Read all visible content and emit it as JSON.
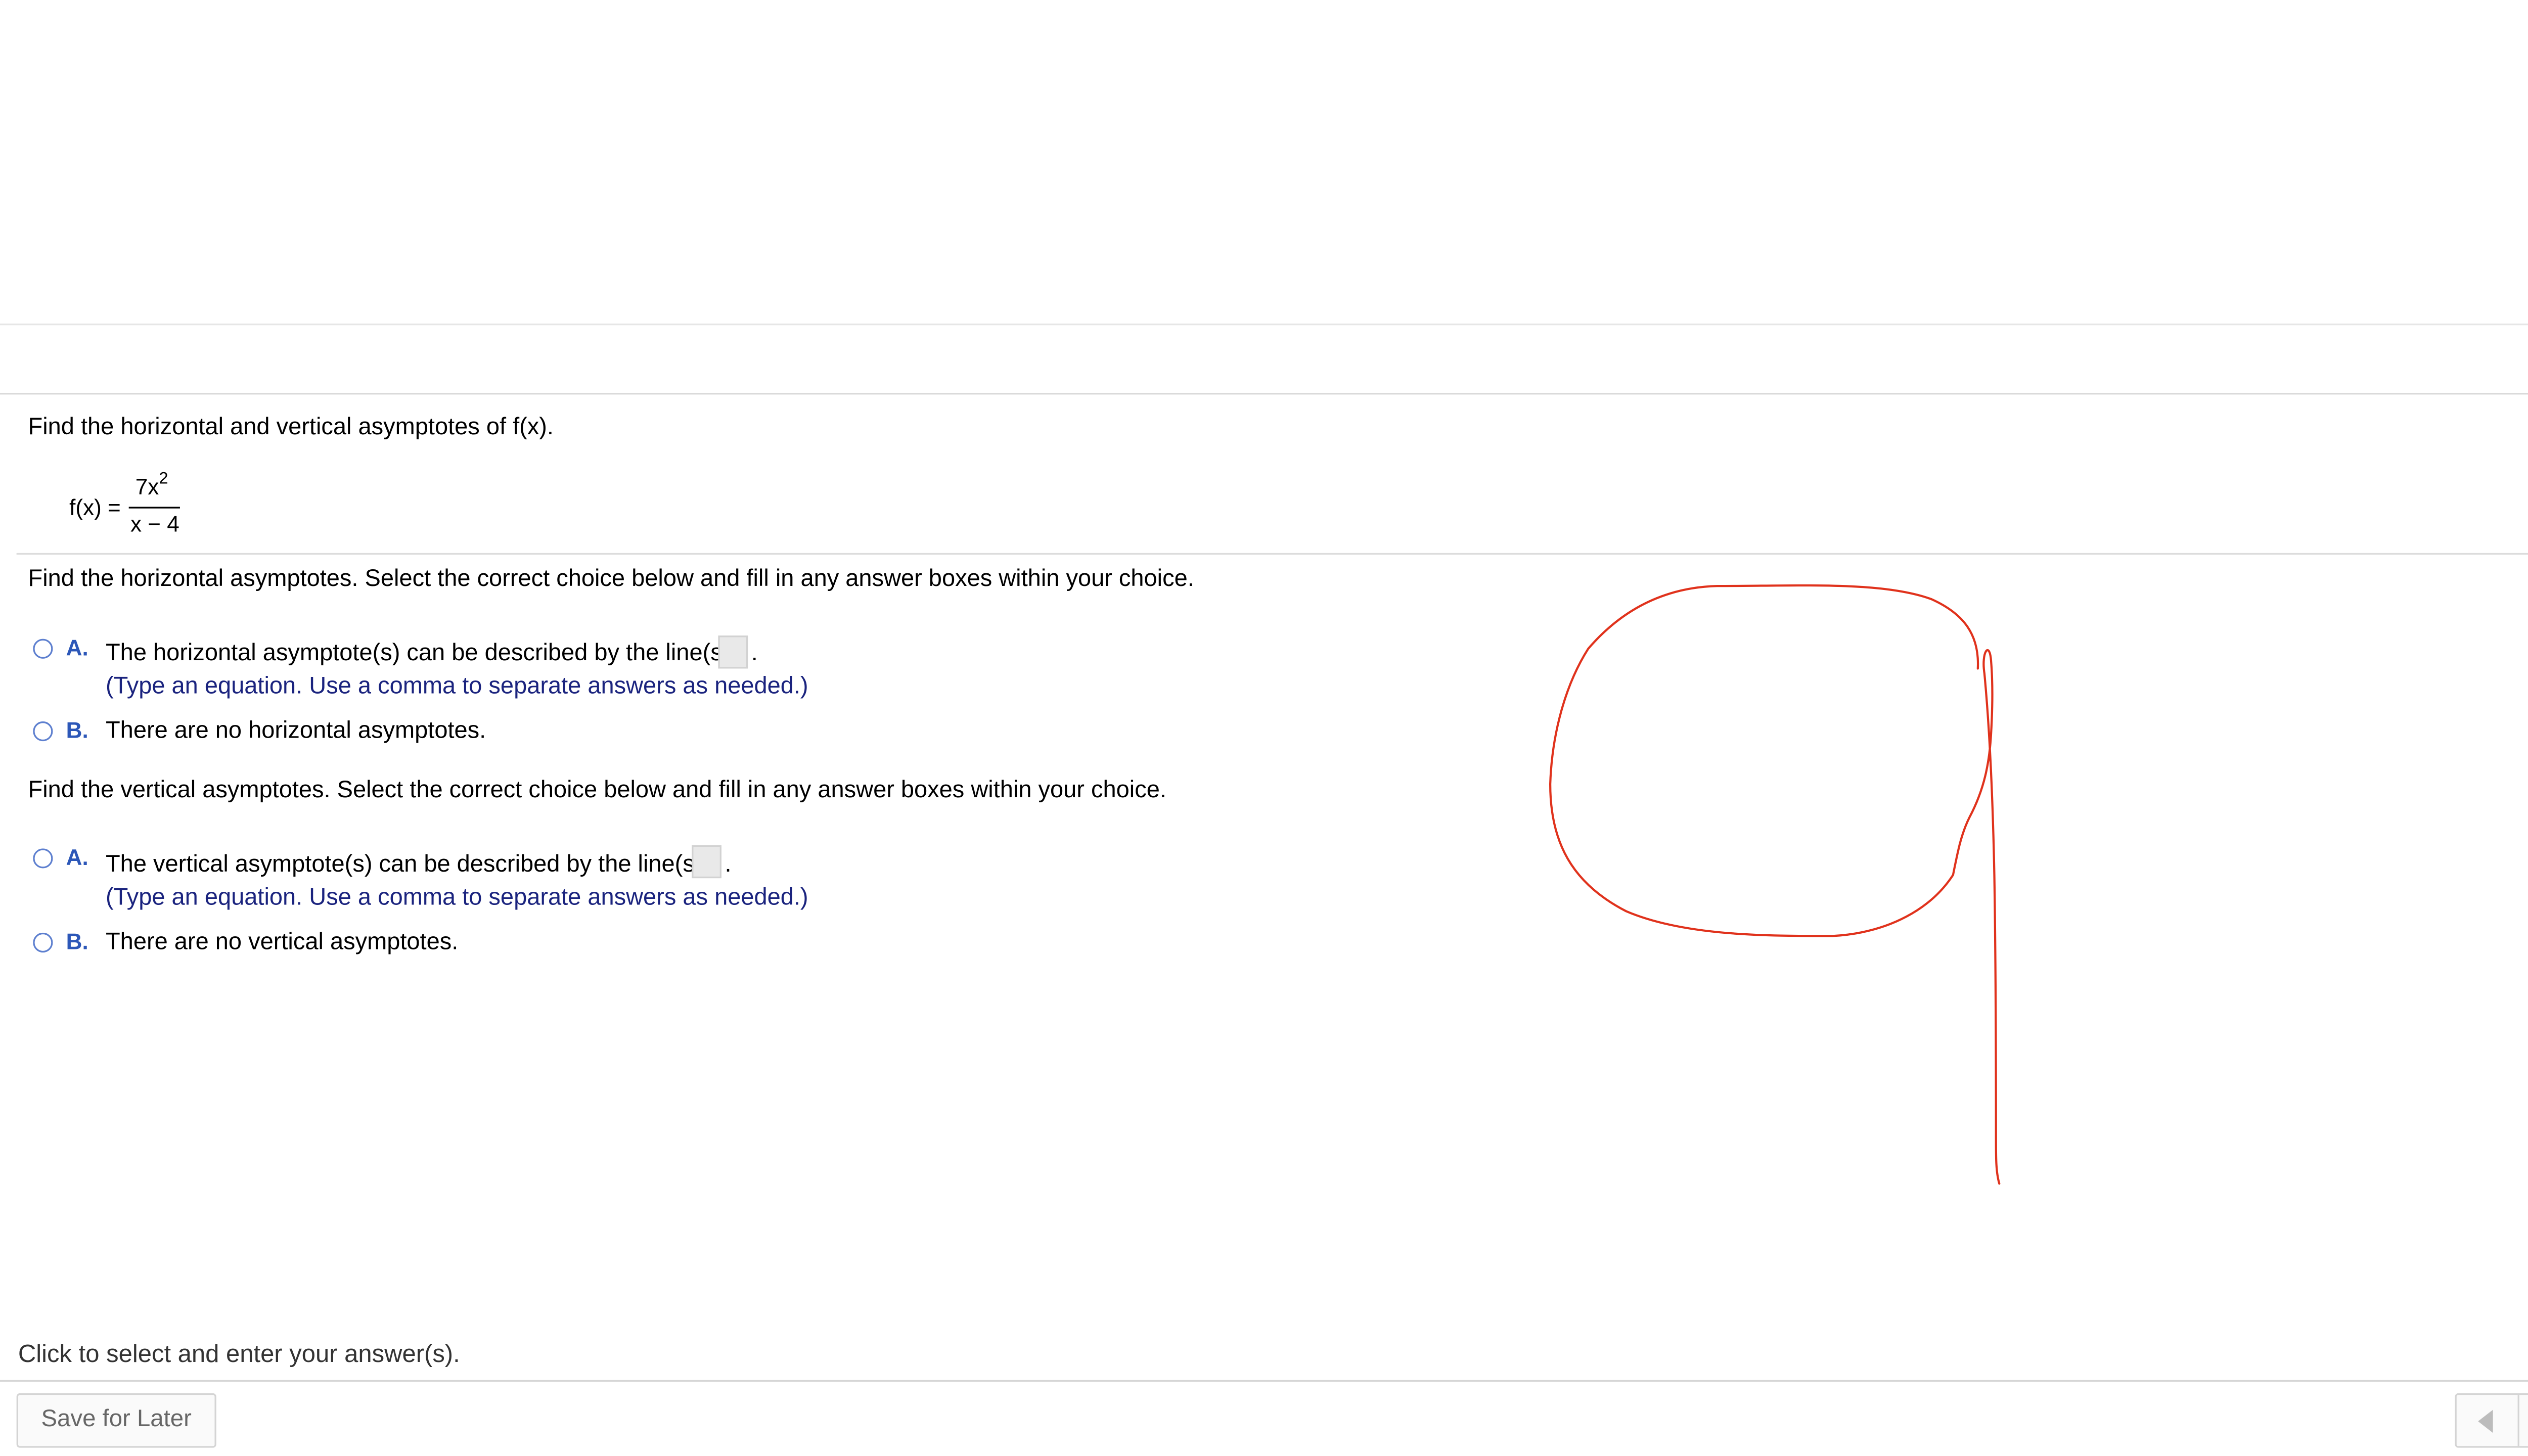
{
  "toolbar": {
    "settings_icon": "gear-icon"
  },
  "question": {
    "prompt": "Find the horizontal and vertical asymptotes of f(x).",
    "function": {
      "label": "f(x) =",
      "numerator_base": "7x",
      "numerator_exponent": "2",
      "denominator": "x − 4"
    }
  },
  "horizontal": {
    "instruction": "Find the horizontal asymptotes. Select the correct choice below and fill in any answer boxes within your choice.",
    "choice_a": {
      "letter": "A.",
      "text": "The horizontal asymptote(s) can be described by the line(s)",
      "answer_value": "",
      "period": ".",
      "hint": "(Type an equation. Use a comma to separate answers as needed.)",
      "selected": false
    },
    "choice_b": {
      "letter": "B.",
      "text": "There are no horizontal asymptotes.",
      "selected": false
    }
  },
  "vertical": {
    "instruction": "Find the vertical asymptotes. Select the correct choice below and fill in any answer boxes within your choice.",
    "choice_a": {
      "letter": "A.",
      "text": "The vertical asymptote(s) can be described by the line(s)",
      "answer_value": "",
      "period": ".",
      "hint": "(Type an equation. Use a comma to separate answers as needed.)",
      "selected": false
    },
    "choice_b": {
      "letter": "B.",
      "text": "There are no vertical asymptotes.",
      "selected": false
    }
  },
  "footer": {
    "status": "Click to select and enter your answer(s).",
    "help_glyph": "?",
    "save_label": "Save for Later",
    "prev_icon": "triangle-left-icon",
    "next_icon": "triangle-right-icon"
  },
  "annotation": {
    "stroke_color": "#e0321c"
  },
  "colors": {
    "choice_letter": "#2c57b8",
    "hint_text": "#1a237e",
    "help_badge": "#f3c44a"
  }
}
